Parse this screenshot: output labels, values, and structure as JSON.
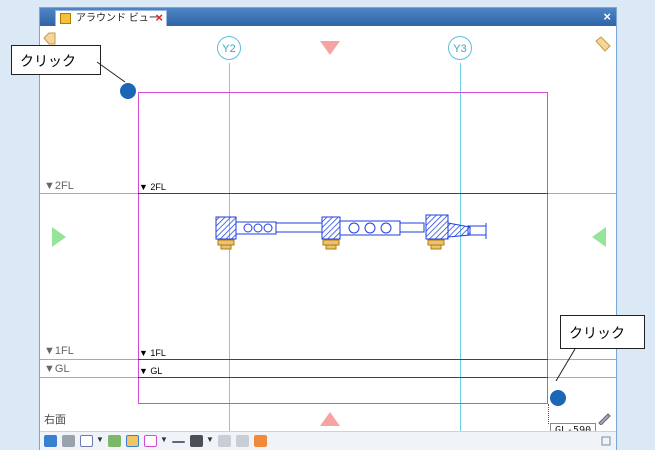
{
  "window": {
    "tab_title": "アラウンド ビュー",
    "tab_close_glyph": "×",
    "close_glyph": "×"
  },
  "grid": {
    "axes": [
      "Y2",
      "Y3"
    ]
  },
  "levels": {
    "left": [
      "▼2FL",
      "▼1FL",
      "▼GL"
    ],
    "inner": [
      "▼ 2FL",
      "▼ 1FL",
      "▼ GL"
    ]
  },
  "view_name": "右面",
  "annotations": {
    "callout_1": "クリック",
    "callout_2": "クリック"
  },
  "tooltip": "GL-590",
  "colors": {
    "view_box": "#d44bd4",
    "grid_line": "#6fd0e6",
    "model": "#1f3fe0",
    "nav_triangle_vertical": "#f7a3a3",
    "nav_triangle_horizontal": "#96e49a",
    "marker_dot": "#1c66b6"
  },
  "toolbar": {
    "icons": [
      "view-cube-icon",
      "box-icon",
      "eye-icon",
      "grid-icon",
      "rotate-icon",
      "rect-icon",
      "line-icon",
      "camera-icon",
      "export-icon",
      "import-icon",
      "link-icon"
    ]
  }
}
